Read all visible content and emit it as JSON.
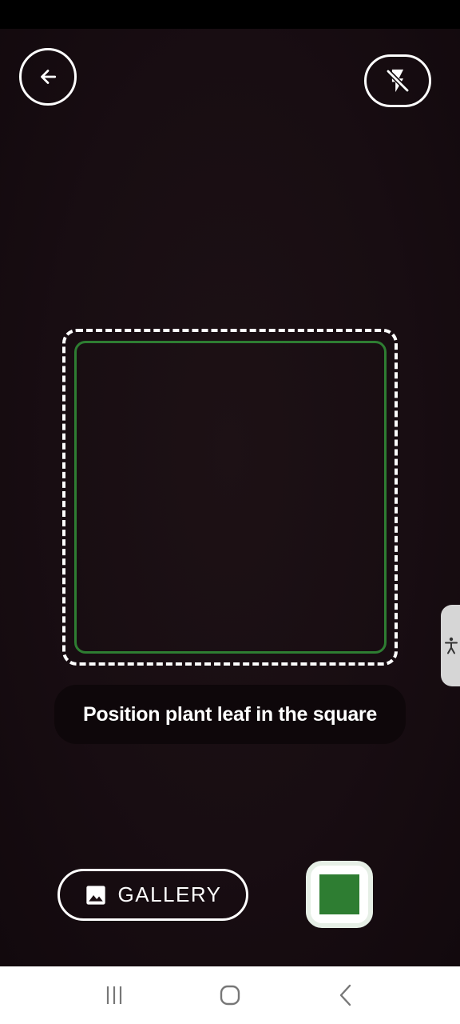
{
  "camera": {
    "hint": "Position plant leaf in the square",
    "gallery_label": "GALLERY"
  },
  "icons": {
    "back": "arrow-left-icon",
    "flash": "flash-off-icon",
    "gallery": "image-icon",
    "accessibility": "accessibility-icon",
    "nav_recents": "recents-icon",
    "nav_home": "home-icon",
    "nav_back": "back-chevron-icon"
  },
  "colors": {
    "accent": "#2e7d32",
    "background": "#180d12",
    "pill_background": "#0e070a"
  }
}
